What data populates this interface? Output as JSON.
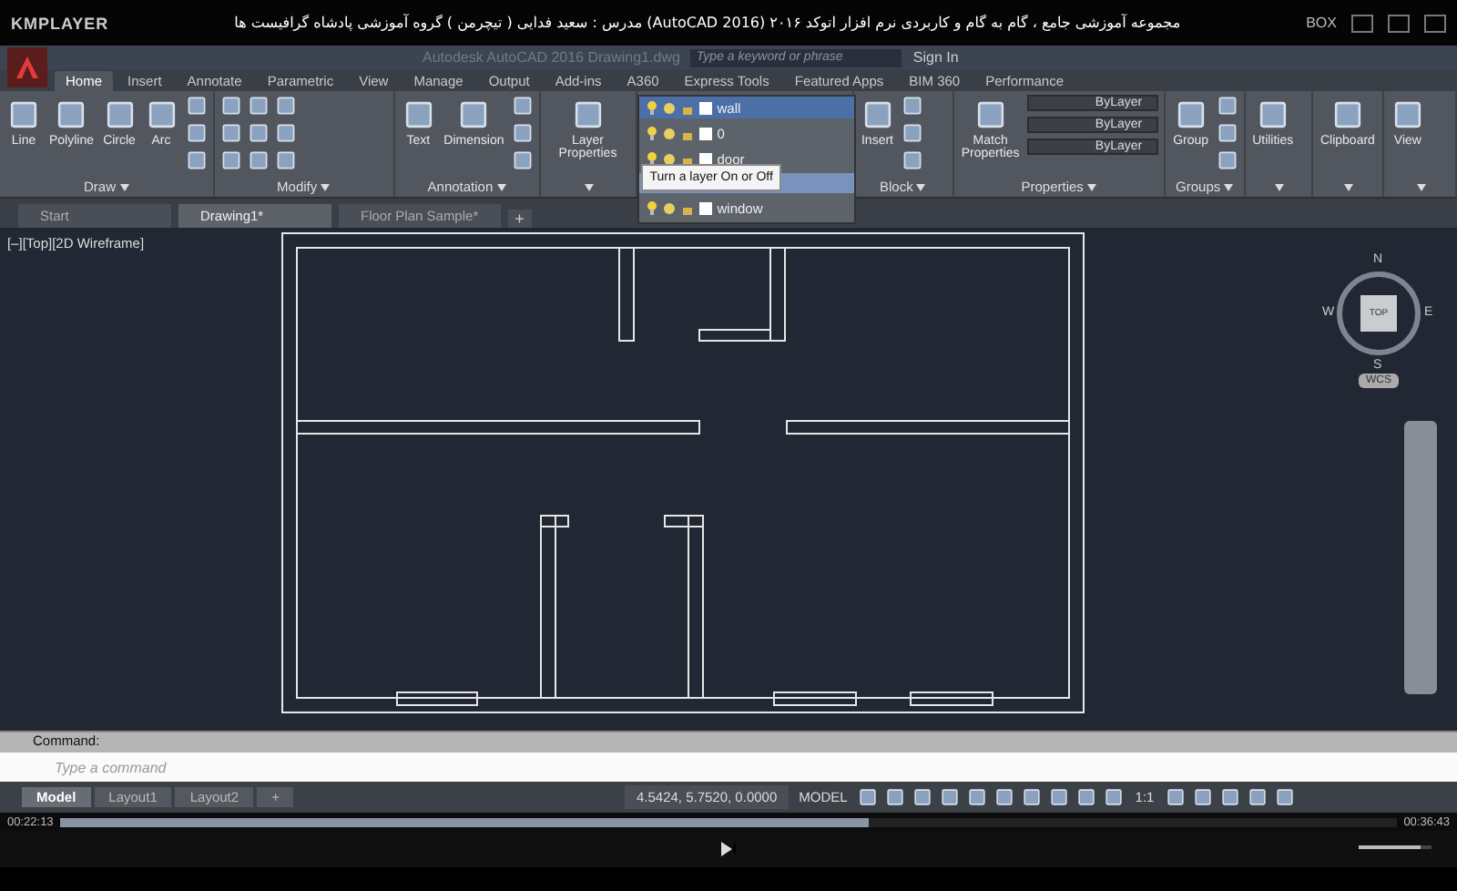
{
  "player": {
    "brand": "KMPLAYER",
    "video_title": "مجموعه آموزشی جامع ، گام به گام و کاربردی نرم افزار  اتوکد ۲۰۱۶ (AutoCAD 2016)  مدرس : سعید فدایی ( تیچرمن ) گروه آموزشی پادشاه گرافیست ها",
    "box_label": "BOX"
  },
  "title_bar": {
    "document_title": "Autodesk AutoCAD 2016    Drawing1.dwg",
    "search_placeholder": "Type a keyword or phrase",
    "sign_in": "Sign In"
  },
  "ribbon_tabs": [
    {
      "label": "Home",
      "selected": true
    },
    {
      "label": "Insert",
      "selected": false
    },
    {
      "label": "Annotate",
      "selected": false
    },
    {
      "label": "Parametric",
      "selected": false
    },
    {
      "label": "View",
      "selected": false
    },
    {
      "label": "Manage",
      "selected": false
    },
    {
      "label": "Output",
      "selected": false
    },
    {
      "label": "Add-ins",
      "selected": false
    },
    {
      "label": "A360",
      "selected": false
    },
    {
      "label": "Express Tools",
      "selected": false
    },
    {
      "label": "Featured Apps",
      "selected": false
    },
    {
      "label": "BIM 360",
      "selected": false
    },
    {
      "label": "Performance",
      "selected": false
    }
  ],
  "ribbon_panels": [
    {
      "title": "Draw",
      "tools": [
        "Line",
        "Polyline",
        "Circle",
        "Arc"
      ],
      "small_icons": true
    },
    {
      "title": "Modify",
      "small_icons": true
    },
    {
      "title": "Annotation",
      "tools": [
        "Text",
        "Dimension"
      ],
      "small_icons": true
    },
    {
      "tools": [
        "Layer Properties"
      ],
      "layer_control": true
    },
    {
      "title": "Block",
      "tools": [
        "Insert"
      ],
      "small_icons": true
    },
    {
      "title": "Properties",
      "tools": [
        "Match Properties"
      ],
      "dropdowns": [
        "ByLayer",
        "ByLayer",
        "ByLayer"
      ]
    },
    {
      "title": "Groups",
      "tools": [
        "Group"
      ],
      "small_icons": true
    },
    {
      "tools": [
        "Utilities"
      ]
    },
    {
      "tools": [
        "Clipboard"
      ]
    },
    {
      "tools": [
        "View"
      ]
    }
  ],
  "layer_dropdown": {
    "current": "wall",
    "layers": [
      "0",
      "door",
      "window"
    ],
    "tooltip": "Turn a layer On or Off"
  },
  "document_tabs": [
    {
      "label": "Start",
      "selected": false
    },
    {
      "label": "Drawing1*",
      "selected": true
    },
    {
      "label": "Floor Plan Sample*",
      "selected": false
    }
  ],
  "new_document_tab": "+",
  "viewport": {
    "label": "[–][Top][2D Wireframe]",
    "viewcube": {
      "face": "TOP",
      "north": "N",
      "south": "S",
      "east": "E",
      "west": "W",
      "ucs": "WCS"
    }
  },
  "command_line": {
    "history": "Command:",
    "placeholder": "Type a command"
  },
  "layout_tabs": [
    {
      "label": "Model",
      "selected": true
    },
    {
      "label": "Layout1",
      "selected": false
    },
    {
      "label": "Layout2",
      "selected": false
    }
  ],
  "new_layout_tab": "+",
  "status_bar": {
    "coordinates": "4.5424, 5.7520, 0.0000",
    "space": "MODEL",
    "scale": "1:1"
  },
  "playback": {
    "elapsed": "00:22:13",
    "total": "00:36:43",
    "level": 0.605,
    "volume": {
      "level": 0.85
    }
  }
}
